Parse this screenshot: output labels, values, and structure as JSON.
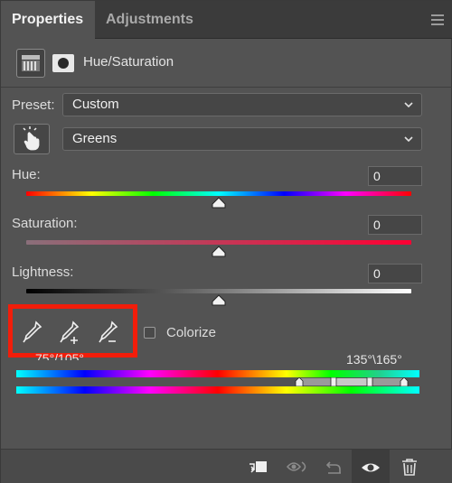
{
  "tabs": [
    {
      "label": "Properties",
      "active": true
    },
    {
      "label": "Adjustments",
      "active": false
    }
  ],
  "header": {
    "title": "Hue/Saturation",
    "icons": [
      "adjustment-layer-icon",
      "layer-mask-icon"
    ]
  },
  "preset": {
    "label": "Preset:",
    "value": "Custom"
  },
  "channel": {
    "value": "Greens"
  },
  "hue": {
    "label": "Hue:",
    "value": "0",
    "fraction": 0.5
  },
  "saturation": {
    "label": "Saturation:",
    "value": "0",
    "fraction": 0.5
  },
  "lightness": {
    "label": "Lightness:",
    "value": "0",
    "fraction": 0.5
  },
  "eyedroppers": [
    "eyedropper-icon",
    "eyedropper-add-icon",
    "eyedropper-subtract-icon"
  ],
  "colorize": {
    "label": "Colorize",
    "checked": false
  },
  "range": {
    "left_text": "75°/105°",
    "right_text": "135°\\165°"
  },
  "bottom_icons": [
    "clip-to-layer-icon",
    "view-previous-state-icon",
    "reset-icon",
    "visibility-eye-icon",
    "trash-icon"
  ],
  "colors": {
    "highlight": "#f21d0a",
    "panel_bg": "#535353",
    "tab_bg": "#3b3b3b"
  }
}
